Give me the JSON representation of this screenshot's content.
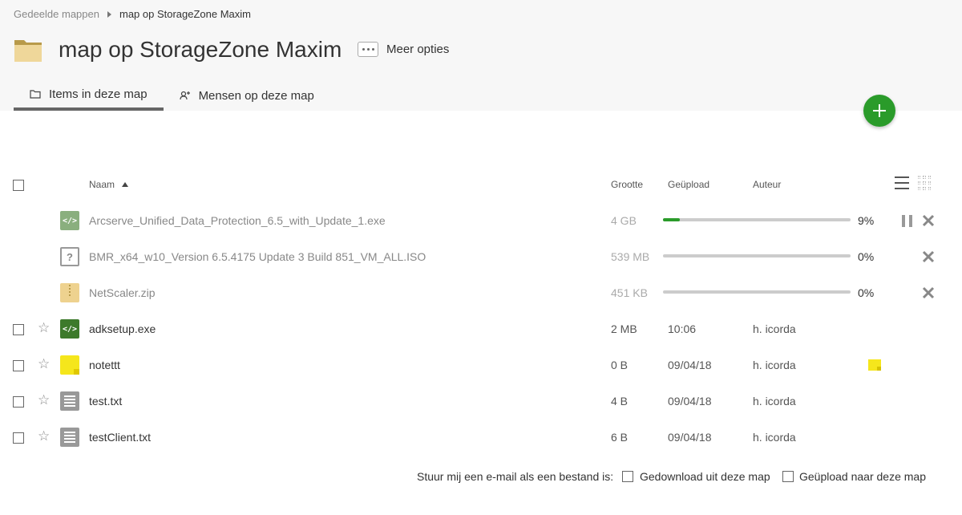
{
  "breadcrumb": {
    "parent": "Gedeelde mappen",
    "current": "map op StorageZone Maxim"
  },
  "page": {
    "title": "map op StorageZone Maxim",
    "more_options": "Meer opties"
  },
  "tabs": [
    {
      "label": "Items in deze map",
      "icon": "folder-outline-icon",
      "active": true
    },
    {
      "label": "Mensen op deze map",
      "icon": "add-person-icon",
      "active": false
    }
  ],
  "table": {
    "headers": {
      "name": "Naam",
      "size": "Grootte",
      "uploaded": "Geüpload",
      "author": "Auteur"
    },
    "uploads": [
      {
        "name": "Arcserve_Unified_Data_Protection_6.5_with_Update_1.exe",
        "size": "4 GB",
        "progress": 9,
        "progress_label": "9%",
        "type": "exe",
        "paused_control": true
      },
      {
        "name": "BMR_x64_w10_Version 6.5.4175 Update 3 Build 851_VM_ALL.ISO",
        "size": "539 MB",
        "progress": 0,
        "progress_label": "0%",
        "type": "iso",
        "paused_control": false
      },
      {
        "name": "NetScaler.zip",
        "size": "451 KB",
        "progress": 0,
        "progress_label": "0%",
        "type": "zip",
        "paused_control": false
      }
    ],
    "files": [
      {
        "name": "adksetup.exe",
        "size": "2 MB",
        "uploaded": "10:06",
        "author": "h. icorda",
        "type": "exe"
      },
      {
        "name": "notettt",
        "size": "0 B",
        "uploaded": "09/04/18",
        "author": "h. icorda",
        "type": "note",
        "has_note": true
      },
      {
        "name": "test.txt",
        "size": "4 B",
        "uploaded": "09/04/18",
        "author": "h. icorda",
        "type": "txt"
      },
      {
        "name": "testClient.txt",
        "size": "6 B",
        "uploaded": "09/04/18",
        "author": "h. icorda",
        "type": "txt"
      }
    ]
  },
  "footer": {
    "prompt": "Stuur mij een e-mail als een bestand is:",
    "option_downloaded": "Gedownload uit deze map",
    "option_uploaded": "Geüpload naar deze map"
  },
  "colors": {
    "accent": "#2a9b2a",
    "header_bg": "#f7f7f7",
    "note": "#f5e61c"
  }
}
